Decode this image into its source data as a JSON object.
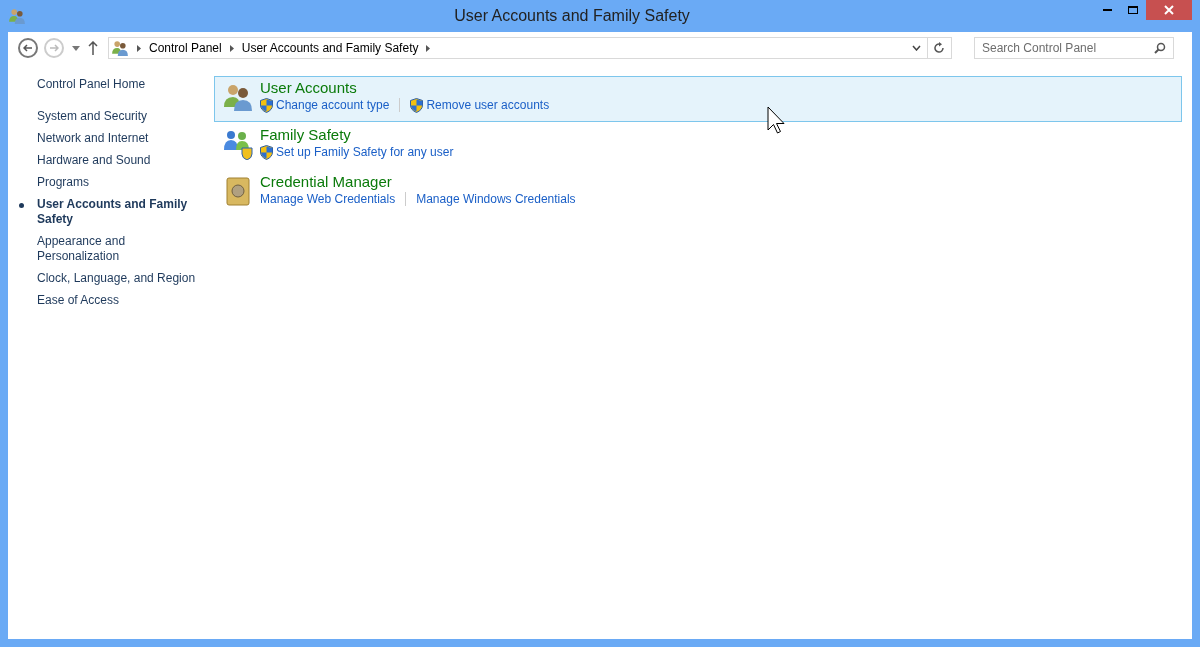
{
  "window": {
    "title": "User Accounts and Family Safety"
  },
  "address_bar": {
    "breadcrumbs": [
      "Control Panel",
      "User Accounts and Family Safety"
    ]
  },
  "search": {
    "placeholder": "Search Control Panel"
  },
  "sidebar": {
    "home": "Control Panel Home",
    "items": [
      {
        "label": "System and Security",
        "selected": false
      },
      {
        "label": "Network and Internet",
        "selected": false
      },
      {
        "label": "Hardware and Sound",
        "selected": false
      },
      {
        "label": "Programs",
        "selected": false
      },
      {
        "label": "User Accounts and Family Safety",
        "selected": true
      },
      {
        "label": "Appearance and Personalization",
        "selected": false
      },
      {
        "label": "Clock, Language, and Region",
        "selected": false
      },
      {
        "label": "Ease of Access",
        "selected": false
      }
    ]
  },
  "categories": [
    {
      "kind": "users",
      "title": "User Accounts",
      "highlighted": true,
      "links": [
        {
          "label": "Change account type",
          "shield": true
        },
        {
          "label": "Remove user accounts",
          "shield": true
        }
      ]
    },
    {
      "kind": "family",
      "title": "Family Safety",
      "highlighted": false,
      "links": [
        {
          "label": "Set up Family Safety for any user",
          "shield": true
        }
      ]
    },
    {
      "kind": "vault",
      "title": "Credential Manager",
      "highlighted": false,
      "links": [
        {
          "label": "Manage Web Credentials",
          "shield": false
        },
        {
          "label": "Manage Windows Credentials",
          "shield": false
        }
      ]
    }
  ]
}
